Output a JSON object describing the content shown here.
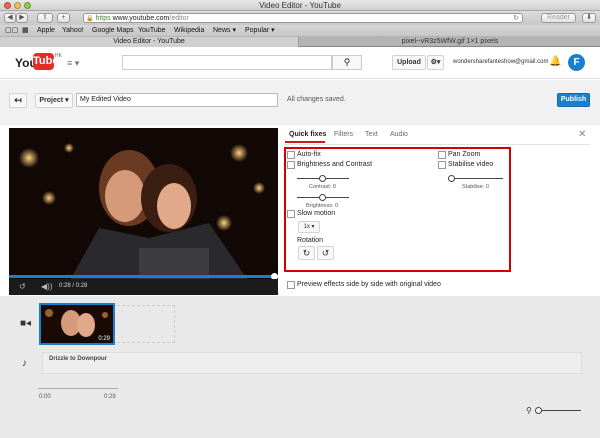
{
  "window": {
    "title": "Video Editor - YouTube"
  },
  "browser": {
    "url_scheme": "https",
    "url_domain": "www.youtube.com",
    "url_path": "/editor",
    "reader_label": "Reader",
    "bookmarks": [
      "Apple",
      "Yahoo!",
      "Google Maps",
      "YouTube",
      "Wikipedia",
      "News ▾",
      "Popular ▾"
    ],
    "tabs": [
      "Video Editor - YouTube",
      "pixel--vR3z5WfW.gif 1×1 pixels"
    ]
  },
  "header": {
    "logo_you": "You",
    "logo_tube": "Tube",
    "logo_region": "HK",
    "upload_label": "Upload",
    "account_email": "wondersharefanteshow@gmail.com",
    "avatar_letter": "F"
  },
  "editor": {
    "project_label": "Project ▾",
    "project_title": "My Edited Video",
    "save_status": "All changes saved.",
    "publish_label": "Publish"
  },
  "player": {
    "time": "0:28 / 0:28",
    "progress": 0.98
  },
  "panel": {
    "tabs": [
      "Quick fixes",
      "Filters",
      "Text",
      "Audio"
    ],
    "active_tab": "Quick fixes",
    "auto_fix": "Auto-fix",
    "brightness_contrast": "Brightness and Contrast",
    "contrast_label": "Contrast: 0",
    "brightness_label": "Brightness: 0",
    "slow_motion": "Slow motion",
    "slow_value": "1x ▾",
    "rotation": "Rotation",
    "pan_zoom": "Pan Zoom",
    "stabilise": "Stabilise video",
    "stabilise_label": "Stabilise: 0",
    "preview_label": "Preview effects side by side with original video"
  },
  "timeline": {
    "clip_time": "0:29",
    "audio_track": "Drizzle to Downpour",
    "ruler": [
      "0:00",
      "0:29"
    ]
  }
}
